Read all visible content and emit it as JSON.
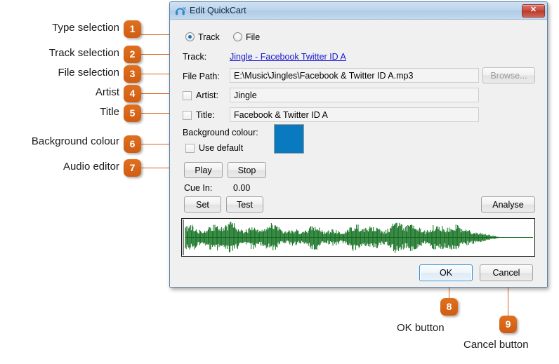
{
  "dialog": {
    "title": "Edit QuickCart",
    "title_icon": "headphones-icon",
    "close_label": "✕",
    "type_selection": {
      "track_label": "Track",
      "file_label": "File",
      "selected": "Track"
    },
    "track": {
      "label": "Track:",
      "link_text": "Jingle - Facebook  Twitter ID A"
    },
    "file_path": {
      "label": "File Path:",
      "value": "E:\\Music\\Jingles\\Facebook & Twitter ID A.mp3",
      "browse_label": "Browse..."
    },
    "artist": {
      "label": "Artist:",
      "value": "Jingle",
      "checked": false
    },
    "title_field": {
      "label": "Title:",
      "value": "Facebook & Twitter ID A",
      "checked": false
    },
    "background_colour": {
      "label": "Background colour:",
      "use_default_label": "Use default",
      "use_default_checked": false,
      "swatch_colour": "#0a7ac0"
    },
    "audio_editor": {
      "play_label": "Play",
      "stop_label": "Stop",
      "cue_in_label": "Cue In:",
      "cue_in_value": "0.00",
      "set_label": "Set",
      "test_label": "Test",
      "analyse_label": "Analyse"
    },
    "footer": {
      "ok_label": "OK",
      "cancel_label": "Cancel"
    }
  },
  "annotations": {
    "accent_colour": "#d9641e",
    "items": [
      {
        "number": "1",
        "label": "Type selection"
      },
      {
        "number": "2",
        "label": "Track selection"
      },
      {
        "number": "3",
        "label": "File selection"
      },
      {
        "number": "4",
        "label": "Artist"
      },
      {
        "number": "5",
        "label": "Title"
      },
      {
        "number": "6",
        "label": "Background colour"
      },
      {
        "number": "7",
        "label": "Audio editor"
      },
      {
        "number": "8",
        "label": "OK button"
      },
      {
        "number": "9",
        "label": "Cancel button"
      }
    ]
  }
}
